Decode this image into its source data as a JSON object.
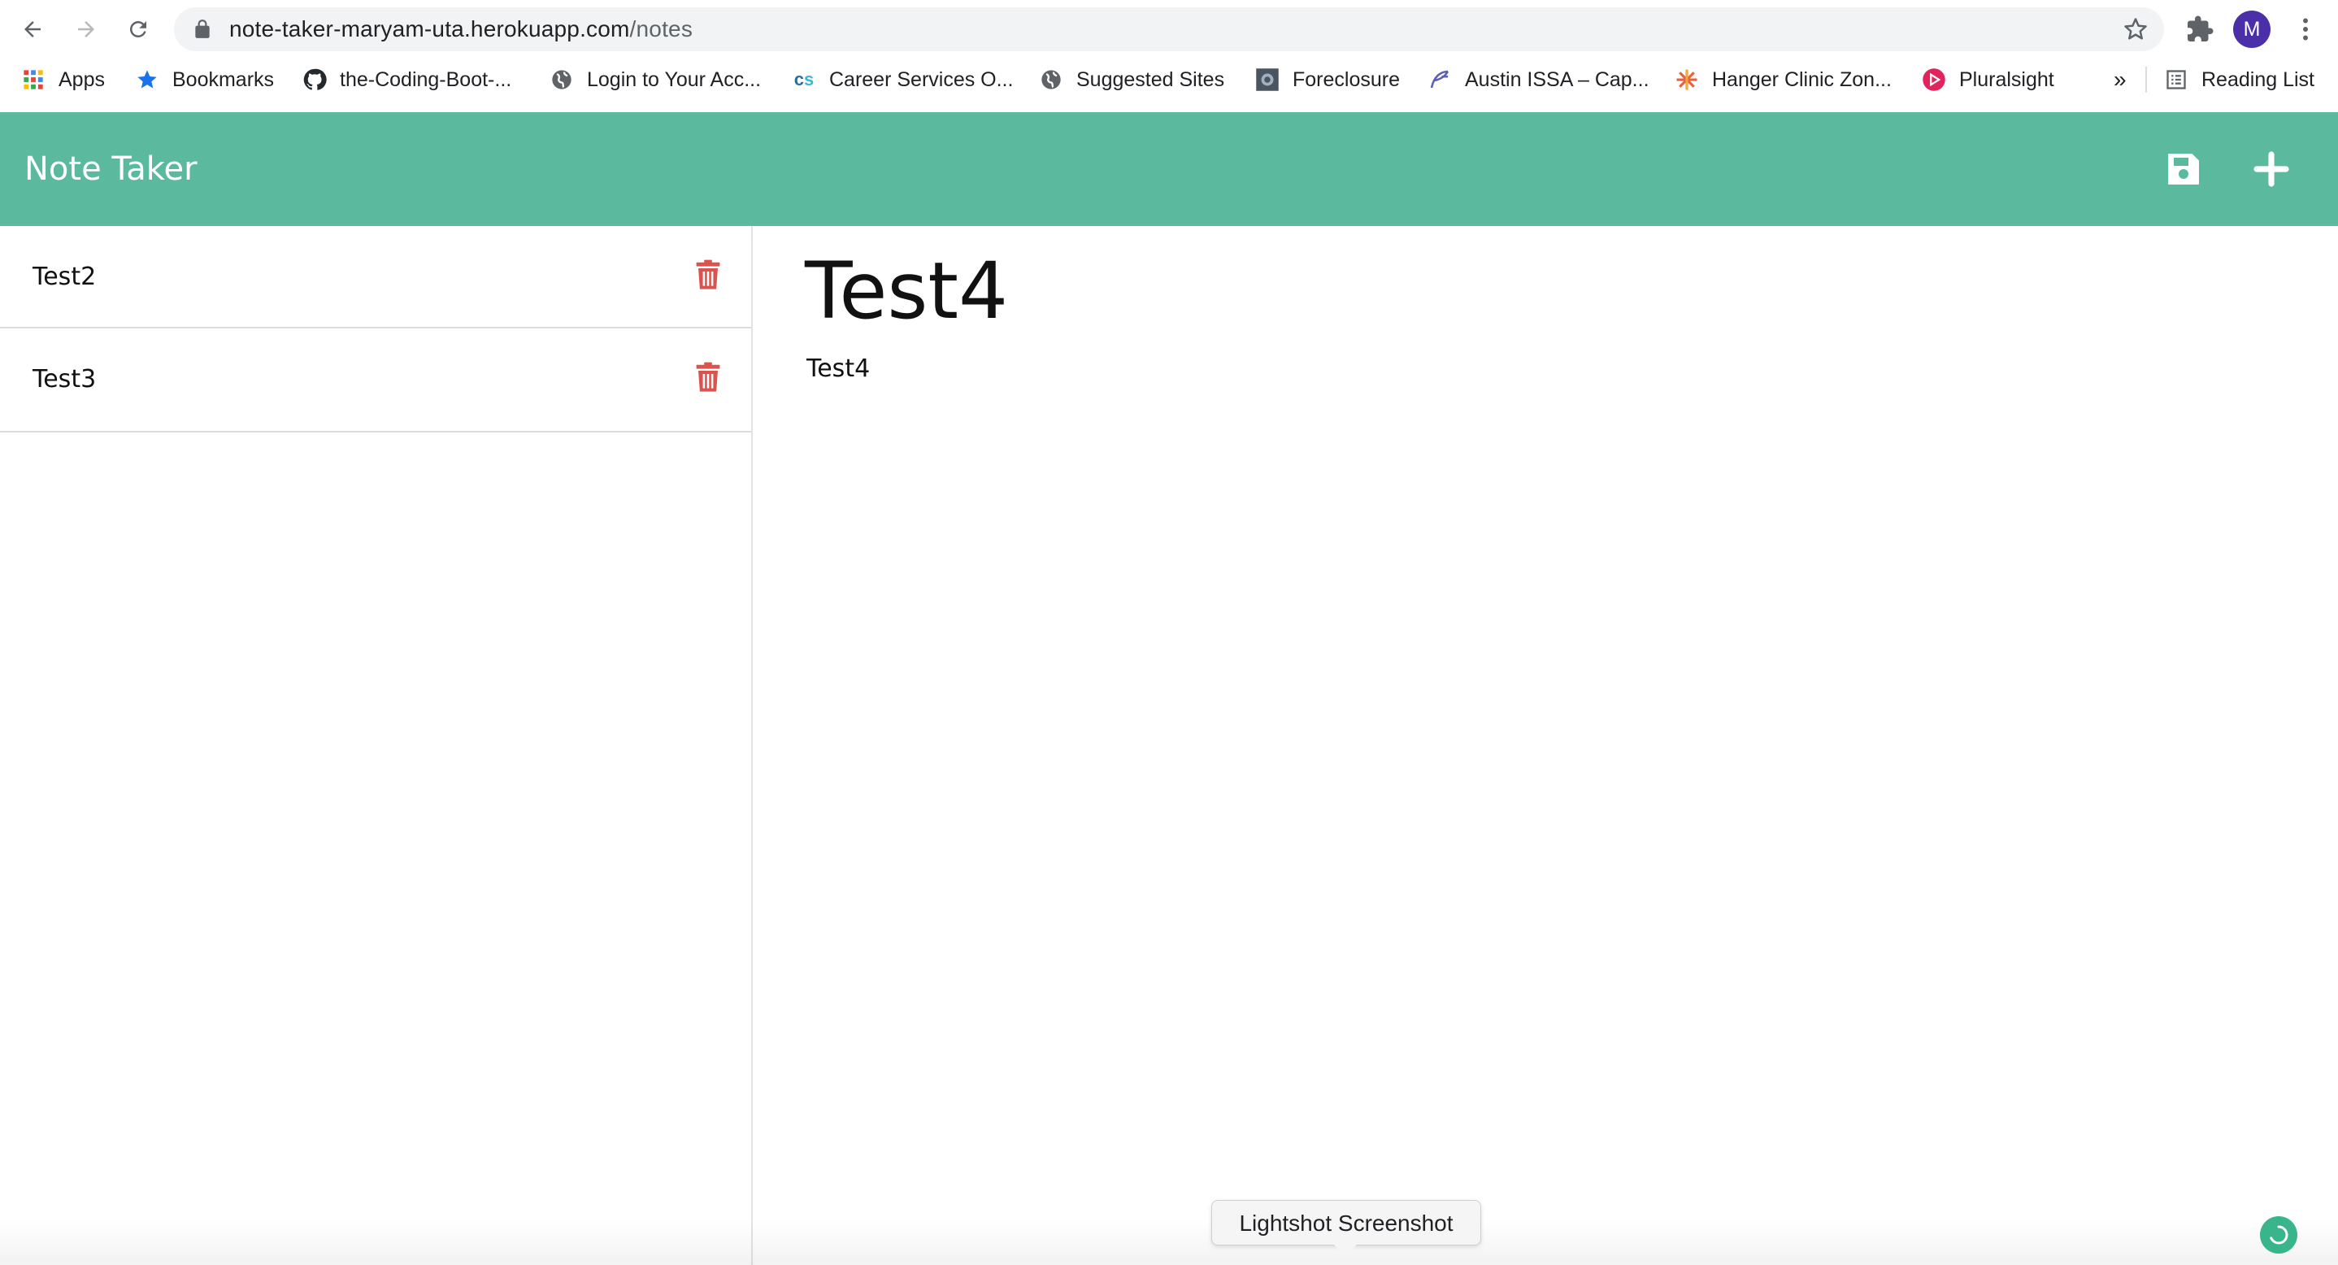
{
  "browser": {
    "url_host": "note-taker-maryam-uta.herokuapp.com",
    "url_path": "/notes",
    "profile_initial": "M"
  },
  "bookmarks": [
    {
      "label": "Apps",
      "icon": "apps-grid-icon"
    },
    {
      "label": "Bookmarks",
      "icon": "star-icon"
    },
    {
      "label": "the-Coding-Boot-...",
      "icon": "github-icon"
    },
    {
      "label": "Login to Your Acc...",
      "icon": "globe-icon"
    },
    {
      "label": "Career Services O...",
      "icon": "cs-icon"
    },
    {
      "label": "Suggested Sites",
      "icon": "globe-icon"
    },
    {
      "label": "Foreclosure",
      "icon": "foreclosure-icon"
    },
    {
      "label": "Austin ISSA – Cap...",
      "icon": "issa-icon"
    },
    {
      "label": "Hanger Clinic Zon...",
      "icon": "hanger-icon"
    },
    {
      "label": "Pluralsight",
      "icon": "pluralsight-icon"
    }
  ],
  "bookmarks_overflow": "»",
  "reading_list": "Reading List",
  "app": {
    "brand": "Note Taker",
    "accent_color": "#5bba9e",
    "delete_color": "#d9534f"
  },
  "notes": [
    {
      "title": "Test2"
    },
    {
      "title": "Test3"
    }
  ],
  "active_note": {
    "title": "Test4",
    "text": "Test4"
  },
  "tooltip": "Lightshot Screenshot"
}
